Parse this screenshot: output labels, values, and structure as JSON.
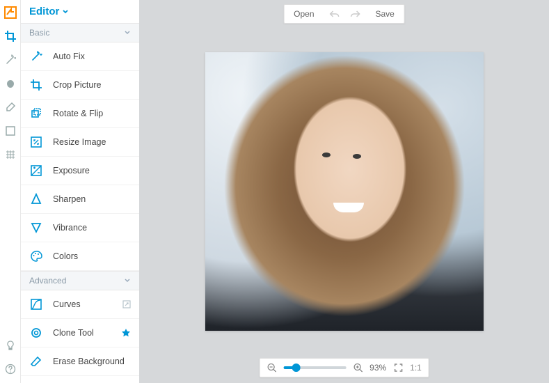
{
  "header": {
    "title": "Editor"
  },
  "topbar": {
    "open": "Open",
    "save": "Save"
  },
  "sections": {
    "basic": "Basic",
    "advanced": "Advanced"
  },
  "tools": {
    "basic": [
      {
        "label": "Auto Fix"
      },
      {
        "label": "Crop Picture"
      },
      {
        "label": "Rotate & Flip"
      },
      {
        "label": "Resize Image"
      },
      {
        "label": "Exposure"
      },
      {
        "label": "Sharpen"
      },
      {
        "label": "Vibrance"
      },
      {
        "label": "Colors"
      }
    ],
    "advanced": [
      {
        "label": "Curves"
      },
      {
        "label": "Clone Tool"
      },
      {
        "label": "Erase Background"
      }
    ]
  },
  "zoom": {
    "percent_label": "93%",
    "one_to_one": "1:1"
  }
}
